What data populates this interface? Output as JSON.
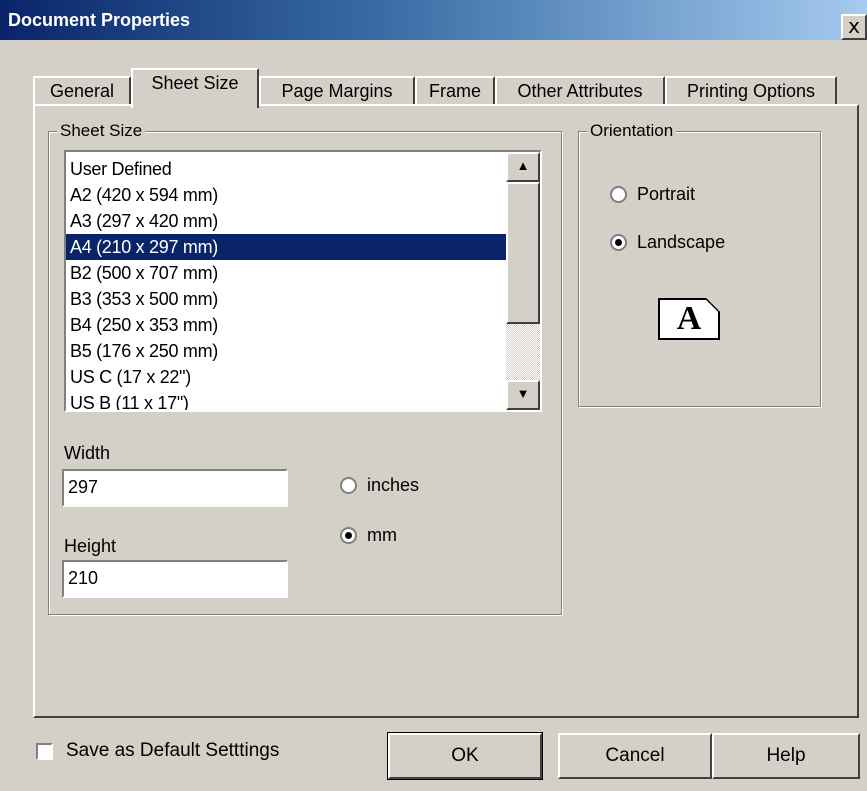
{
  "window": {
    "title": "Document Properties",
    "close_glyph": "x"
  },
  "tabs": [
    {
      "label": "General"
    },
    {
      "label": "Sheet Size"
    },
    {
      "label": "Page Margins"
    },
    {
      "label": "Frame"
    },
    {
      "label": "Other Attributes"
    },
    {
      "label": "Printing Options"
    }
  ],
  "active_tab": "Sheet Size",
  "sheet_size": {
    "group_label": "Sheet Size",
    "items": [
      "User Defined",
      "A2 (420 x 594 mm)",
      "A3 (297 x 420 mm)",
      "A4 (210 x 297 mm)",
      "B2 (500 x 707 mm)",
      "B3 (353 x 500 mm)",
      "B4 (250 x 353 mm)",
      "B5 (176 x 250 mm)",
      "US C (17 x 22\")",
      "US B (11 x 17\")"
    ],
    "selected": "A4 (210 x 297 mm)",
    "width_label": "Width",
    "width_value": "297",
    "height_label": "Height",
    "height_value": "210",
    "unit_inches_label": "inches",
    "unit_mm_label": "mm",
    "selected_unit": "mm"
  },
  "orientation": {
    "group_label": "Orientation",
    "portrait_label": "Portrait",
    "landscape_label": "Landscape",
    "selected": "Landscape",
    "preview_glyph": "A"
  },
  "footer": {
    "save_default_label": "Save as Default Setttings",
    "save_default_checked": false,
    "ok_label": "OK",
    "cancel_label": "Cancel",
    "help_label": "Help"
  },
  "colors": {
    "face": "#d4d0c8",
    "title_start": "#0a246a",
    "title_end": "#a6caf0",
    "selection": "#0a246a"
  },
  "icons": {
    "close": "close-icon",
    "scroll_up": "arrow-up-icon",
    "scroll_down": "arrow-down-icon",
    "orientation_preview": "landscape-page-icon"
  }
}
